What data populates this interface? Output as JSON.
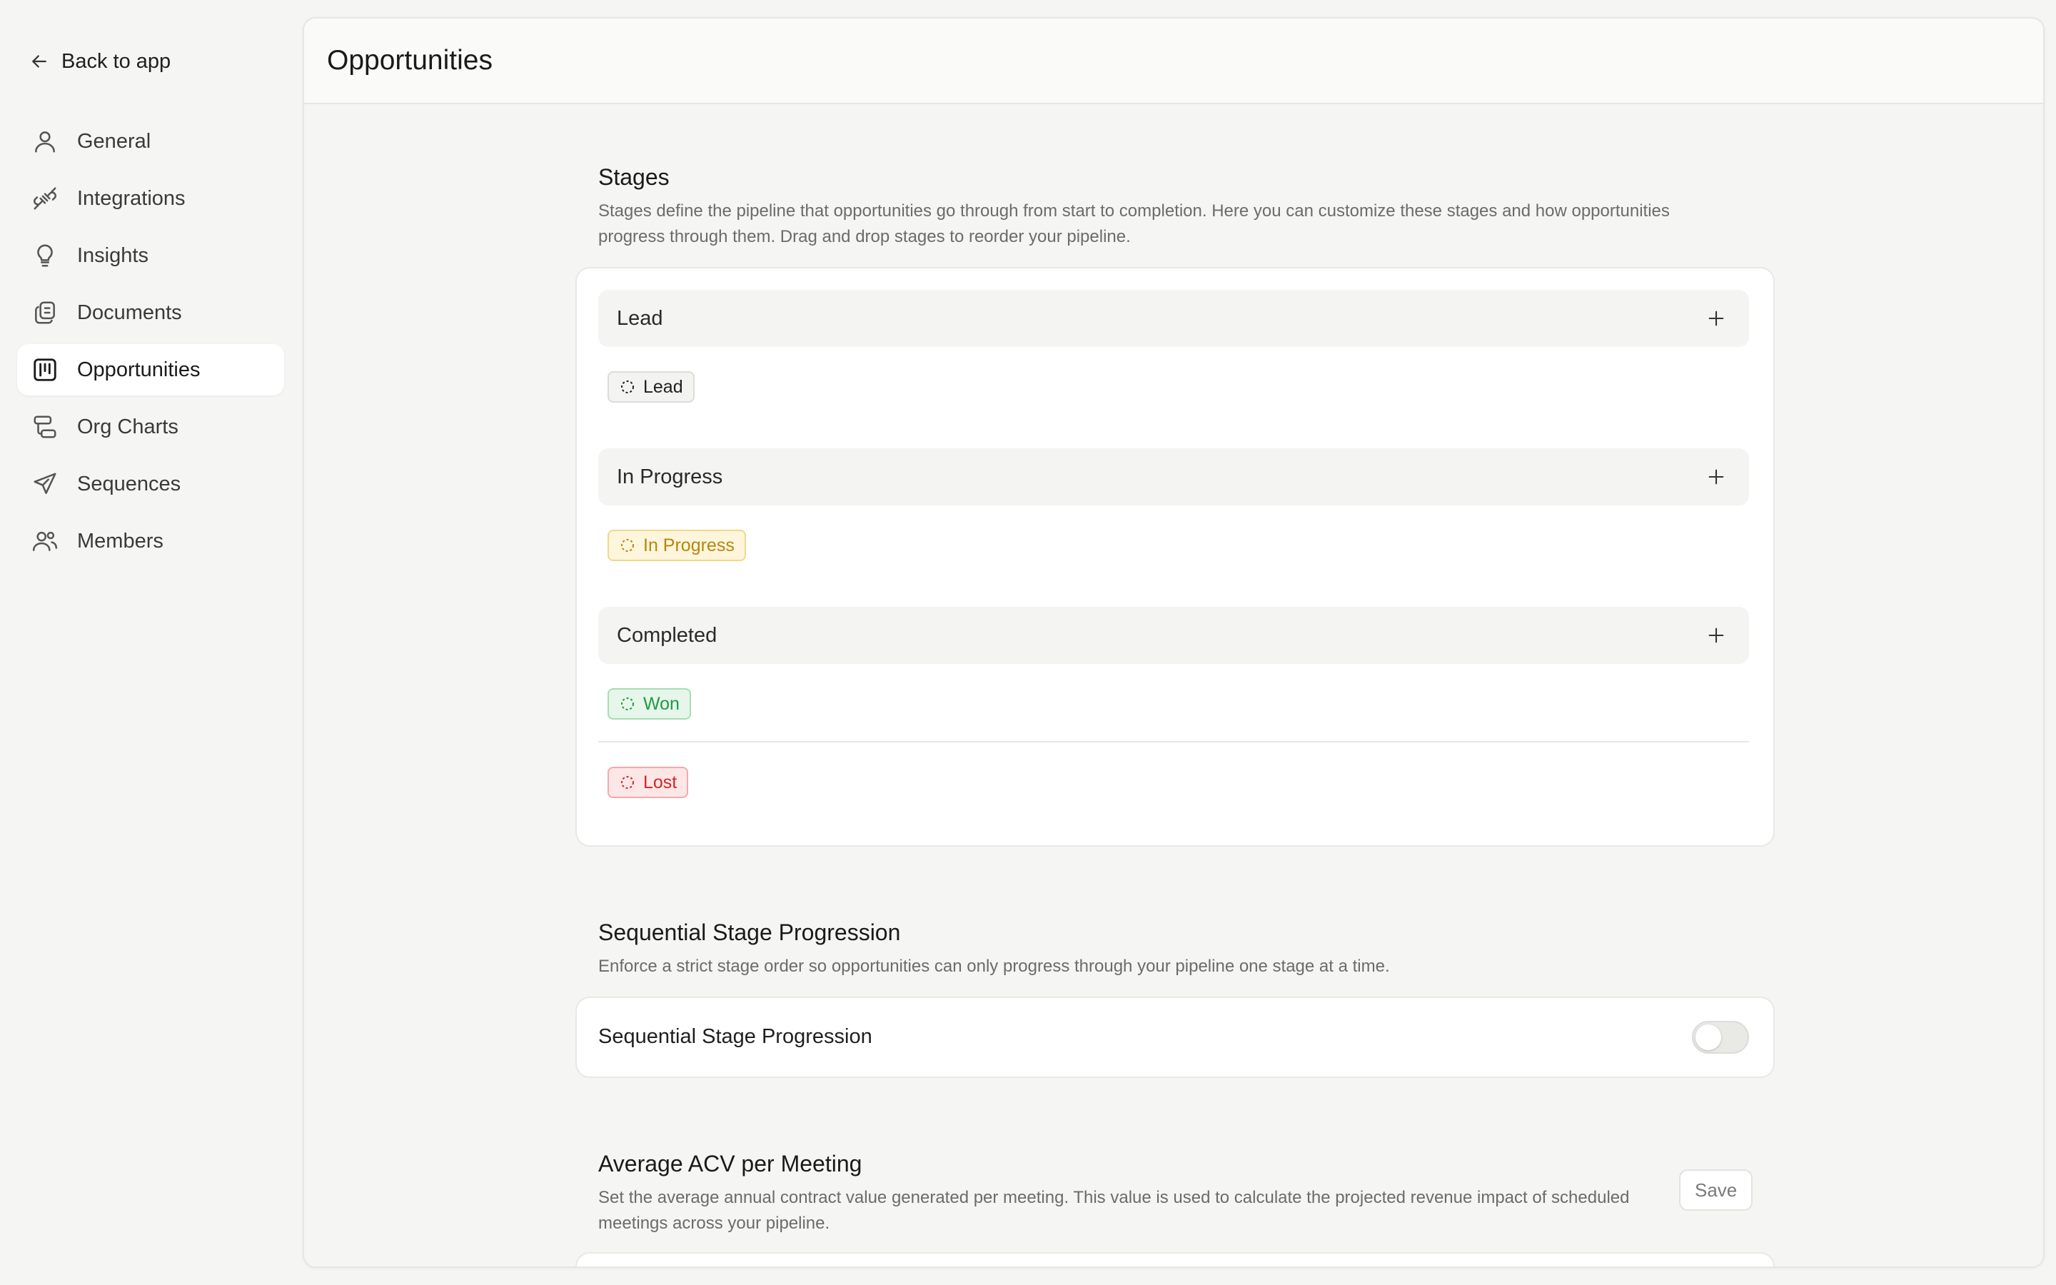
{
  "sidebar": {
    "back_label": "Back to app",
    "items": [
      {
        "label": "General",
        "icon": "user-icon",
        "active": false
      },
      {
        "label": "Integrations",
        "icon": "plug-icon",
        "active": false
      },
      {
        "label": "Insights",
        "icon": "lightbulb-icon",
        "active": false
      },
      {
        "label": "Documents",
        "icon": "documents-icon",
        "active": false
      },
      {
        "label": "Opportunities",
        "icon": "kanban-icon",
        "active": true
      },
      {
        "label": "Org Charts",
        "icon": "org-chart-icon",
        "active": false
      },
      {
        "label": "Sequences",
        "icon": "send-icon",
        "active": false
      },
      {
        "label": "Members",
        "icon": "users-icon",
        "active": false
      }
    ]
  },
  "page": {
    "title": "Opportunities"
  },
  "stages_section": {
    "title": "Stages",
    "description": "Stages define the pipeline that opportunities go through from start to completion. Here you can customize these stages and how opportunities progress through them. Drag and drop stages to reorder your pipeline.",
    "groups": [
      {
        "name": "Lead",
        "badges": [
          {
            "label": "Lead",
            "color": "#1f1f1f"
          }
        ]
      },
      {
        "name": "In Progress",
        "badges": [
          {
            "label": "In Progress",
            "color": "#b7860b"
          }
        ]
      },
      {
        "name": "Completed",
        "badges": [
          {
            "label": "Won",
            "color": "#1f9a43"
          },
          {
            "label": "Lost",
            "color": "#d0262b"
          }
        ]
      }
    ]
  },
  "sequential_section": {
    "title": "Sequential Stage Progression",
    "description": "Enforce a strict stage order so opportunities can only progress through your pipeline one stage at a time.",
    "toggle_label": "Sequential Stage Progression",
    "enabled": false
  },
  "acv_section": {
    "title": "Average ACV per Meeting",
    "description": "Set the average annual contract value generated per meeting. This value is used to calculate the projected revenue impact of scheduled meetings across your pipeline.",
    "save_label": "Save"
  }
}
